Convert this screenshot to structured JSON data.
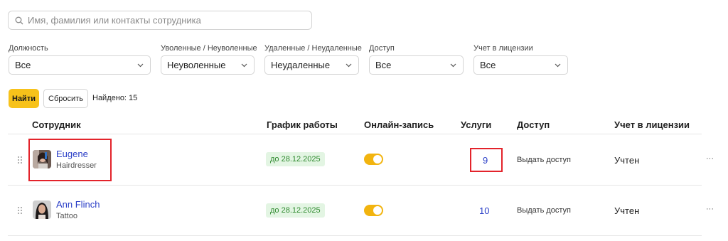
{
  "search": {
    "placeholder": "Имя, фамилия или контакты сотрудника"
  },
  "filters": [
    {
      "label": "Должность",
      "value": "Все"
    },
    {
      "label": "Уволенные / Неуволенные",
      "value": "Неуволенные"
    },
    {
      "label": "Удаленные / Неудаленные",
      "value": "Неудаленные"
    },
    {
      "label": "Доступ",
      "value": "Все"
    },
    {
      "label": "Учет в лицензии",
      "value": "Все"
    }
  ],
  "actions": {
    "find_label": "Найти",
    "reset_label": "Сбросить",
    "found_text": "Найдено: 15"
  },
  "table": {
    "columns": [
      "Сотрудник",
      "График работы",
      "Онлайн-запись",
      "Услуги",
      "Доступ",
      "Учет в лицензии"
    ],
    "rows": [
      {
        "name": "Eugene",
        "role": "Hairdresser",
        "schedule": "до 28.12.2025",
        "online_booking": true,
        "services": "9",
        "access": "Выдать доступ",
        "license": "Учтен",
        "more": "···"
      },
      {
        "name": "Ann Flinch",
        "role": "Tattoo",
        "schedule": "до 28.12.2025",
        "online_booking": true,
        "services": "10",
        "access": "Выдать доступ",
        "license": "Учтен",
        "more": "···"
      }
    ]
  },
  "colors": {
    "accent": "#f7c21a",
    "toggle": "#f2b40f",
    "link": "#2b3fc7",
    "highlight_box": "#e3232b",
    "schedule_bg": "#e3f5e3",
    "schedule_text": "#2f8a2f"
  },
  "icons": {
    "search": "search-icon",
    "chevron": "chevron-down-icon",
    "drag": "drag-handle-icon",
    "more": "more-icon"
  }
}
